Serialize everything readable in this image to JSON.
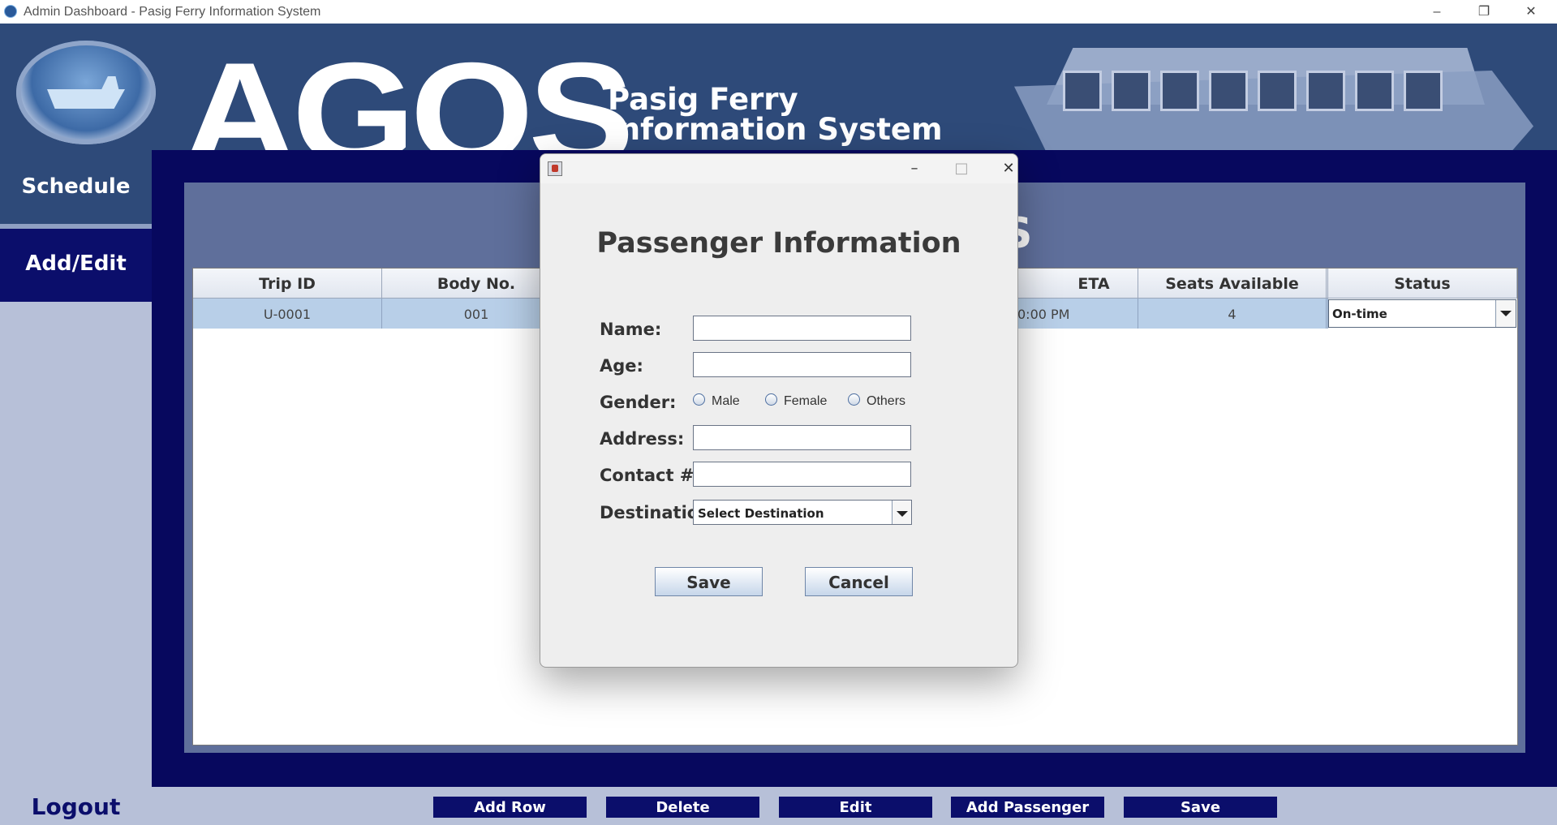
{
  "window": {
    "title": "Admin Dashboard - Pasig Ferry Information System",
    "controls": {
      "minimize": "–",
      "restore": "❐",
      "close": "✕"
    }
  },
  "header": {
    "brand": "AGOS",
    "subtitle_line1": "Pasig Ferry",
    "subtitle_line2": "Information System",
    "colors": {
      "header_bg": "#2e4a79",
      "nav_dark": "#0b0e6b"
    }
  },
  "sidebar": {
    "items": [
      {
        "label": "Schedule"
      },
      {
        "label": "Add/Edit"
      }
    ],
    "logout": "Logout"
  },
  "panel": {
    "title_partial": "S"
  },
  "table": {
    "columns": [
      "Trip ID",
      "Body No.",
      "ETA",
      "Seats Available",
      "Status"
    ],
    "rows": [
      {
        "trip_id": "U-0001",
        "body_no": "001",
        "eta": "0:00 PM",
        "seats_available": "4",
        "status": "On-time"
      }
    ]
  },
  "toolbar": {
    "buttons": [
      "Add Row",
      "Delete",
      "Edit",
      "Add Passenger",
      "Save"
    ]
  },
  "dialog": {
    "window_controls": {
      "minimize": "–",
      "maximize": "□",
      "close": "✕"
    },
    "heading": "Passenger Information",
    "fields": {
      "name": {
        "label": "Name:",
        "value": ""
      },
      "age": {
        "label": "Age:",
        "value": ""
      },
      "gender": {
        "label": "Gender:",
        "options": [
          "Male",
          "Female",
          "Others"
        ]
      },
      "address": {
        "label": "Address:",
        "value": ""
      },
      "contact": {
        "label": "Contact #:",
        "value": ""
      },
      "destination": {
        "label": "Destination:",
        "selected": "Select Destination"
      }
    },
    "buttons": {
      "save": "Save",
      "cancel": "Cancel"
    }
  }
}
